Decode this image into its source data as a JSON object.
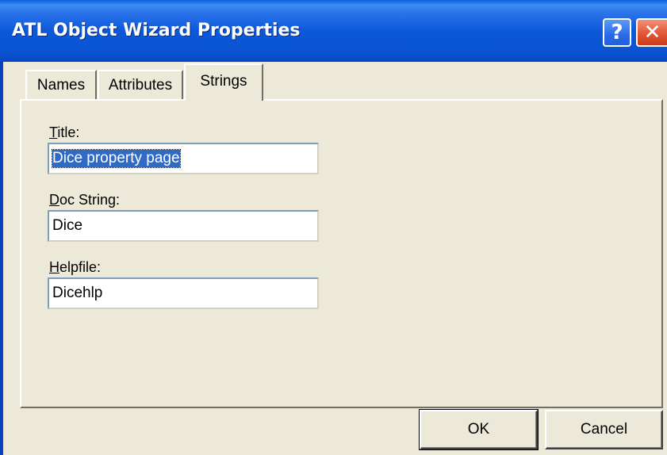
{
  "window": {
    "title": "ATL Object Wizard Properties",
    "help_glyph": "?",
    "close_glyph": "✕",
    "accent_color": "#0a54d2"
  },
  "tabs": [
    {
      "label": "Names",
      "active": false
    },
    {
      "label": "Attributes",
      "active": false
    },
    {
      "label": "Strings",
      "active": true
    }
  ],
  "fields": {
    "title": {
      "label_accel": "T",
      "label_rest": "itle:",
      "value": "Dice property page",
      "selected": true
    },
    "doc_string": {
      "label_accel": "D",
      "label_rest": "oc String:",
      "value": "Dice"
    },
    "helpfile": {
      "label_accel": "H",
      "label_rest": "elpfile:",
      "value": "Dicehlp"
    }
  },
  "buttons": {
    "ok": "OK",
    "cancel": "Cancel"
  }
}
